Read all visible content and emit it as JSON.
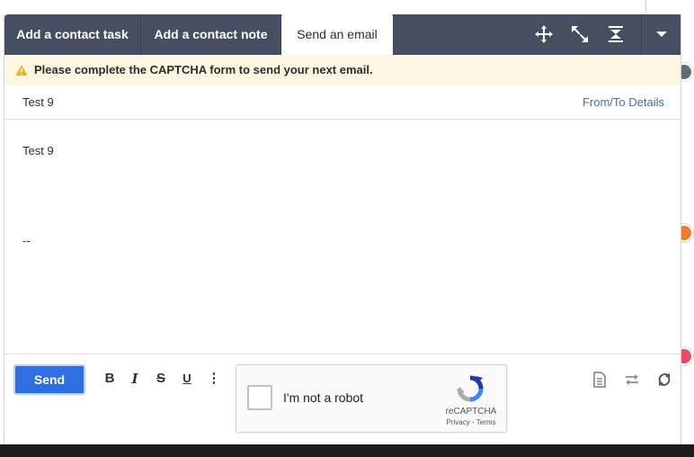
{
  "tabs": [
    {
      "label": "Add a contact task"
    },
    {
      "label": "Add a contact note"
    },
    {
      "label": "Send an email"
    }
  ],
  "toolbar_icons": [
    "move-icon",
    "expand-icon",
    "collapse-icon",
    "chevron-down-icon"
  ],
  "warning": {
    "text": "Please complete the CAPTCHA form to send your next email.",
    "icon": "warning-icon",
    "color": "#f2b21e"
  },
  "email": {
    "subject": "Test 9",
    "from_to_link": "From/To Details",
    "body": "Test 9",
    "signature_separator": "--"
  },
  "bottom": {
    "send_label": "Send",
    "format": {
      "bold": "B",
      "italic": "I",
      "strike": "S",
      "underline": "U",
      "more": "⋮"
    },
    "recaptcha": {
      "label": "I'm not a robot",
      "brand": "reCAPTCHA",
      "links": "Privacy - Terms"
    },
    "right_icons": [
      "template-icon",
      "swap-icon",
      "refresh-icon"
    ]
  },
  "colors": {
    "tabbar": "#464e61",
    "send_button": "#2f6fe4",
    "link": "#3d6fc4",
    "warning_bg": "#fdf6e0"
  }
}
